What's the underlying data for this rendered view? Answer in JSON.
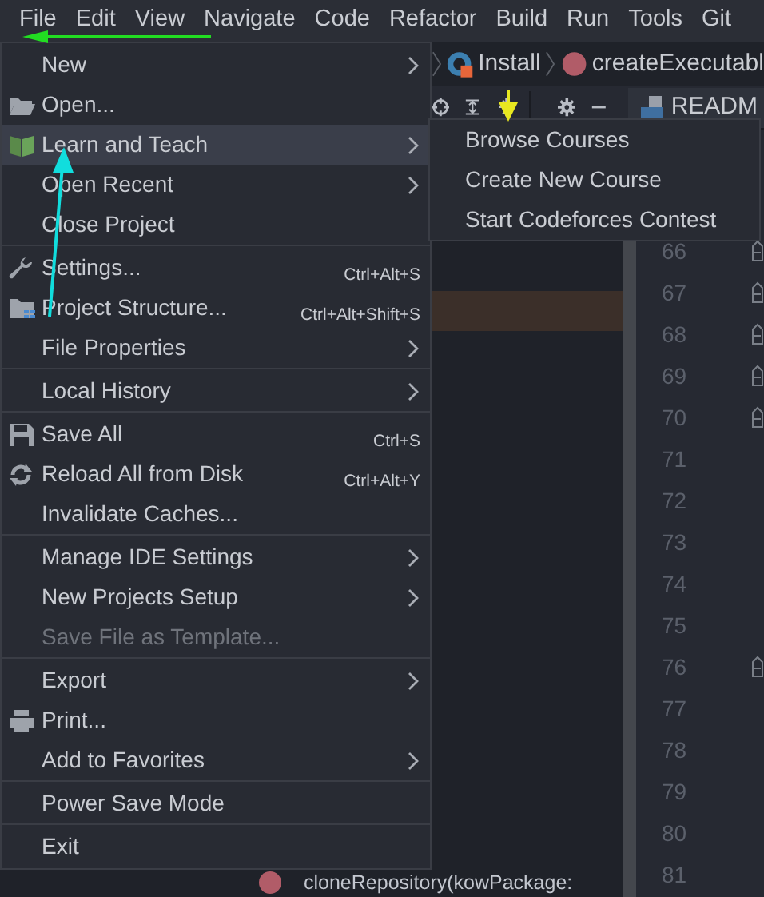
{
  "menu_bar": [
    "File",
    "Edit",
    "View",
    "Navigate",
    "Code",
    "Refactor",
    "Build",
    "Run",
    "Tools",
    "Git"
  ],
  "breadcrumb": [
    "Install",
    "createExecutabl"
  ],
  "editor_tab": "READM",
  "file_menu": {
    "groups": [
      [
        {
          "label": "New",
          "submenu": true,
          "selected": false,
          "disabled": false
        },
        {
          "label": "Open...",
          "submenu": false,
          "selected": false,
          "disabled": false
        },
        {
          "label": "Learn and Teach",
          "submenu": true,
          "selected": true,
          "disabled": false
        },
        {
          "label": "Open Recent",
          "submenu": true,
          "selected": false,
          "disabled": false
        },
        {
          "label": "Close Project",
          "submenu": false,
          "selected": false,
          "disabled": false
        }
      ],
      [
        {
          "label": "Settings...",
          "shortcut": "Ctrl+Alt+S",
          "submenu": false,
          "selected": false,
          "disabled": false
        },
        {
          "label": "Project Structure...",
          "shortcut": "Ctrl+Alt+Shift+S",
          "submenu": false,
          "selected": false,
          "disabled": false
        },
        {
          "label": "File Properties",
          "submenu": true,
          "selected": false,
          "disabled": false
        }
      ],
      [
        {
          "label": "Local History",
          "submenu": true,
          "selected": false,
          "disabled": false
        }
      ],
      [
        {
          "label": "Save All",
          "shortcut": "Ctrl+S",
          "submenu": false,
          "selected": false,
          "disabled": false
        },
        {
          "label": "Reload All from Disk",
          "shortcut": "Ctrl+Alt+Y",
          "submenu": false,
          "selected": false,
          "disabled": false
        },
        {
          "label": "Invalidate Caches...",
          "submenu": false,
          "selected": false,
          "disabled": false
        }
      ],
      [
        {
          "label": "Manage IDE Settings",
          "submenu": true,
          "selected": false,
          "disabled": false
        },
        {
          "label": "New Projects Setup",
          "submenu": true,
          "selected": false,
          "disabled": false
        },
        {
          "label": "Save File as Template...",
          "submenu": false,
          "selected": false,
          "disabled": true
        }
      ],
      [
        {
          "label": "Export",
          "submenu": true,
          "selected": false,
          "disabled": false
        },
        {
          "label": "Print...",
          "submenu": false,
          "selected": false,
          "disabled": false
        },
        {
          "label": "Add to Favorites",
          "submenu": true,
          "selected": false,
          "disabled": false
        }
      ],
      [
        {
          "label": "Power Save Mode",
          "submenu": false,
          "selected": false,
          "disabled": false
        }
      ],
      [
        {
          "label": "Exit",
          "submenu": false,
          "selected": false,
          "disabled": false
        }
      ]
    ]
  },
  "submenu": {
    "items": [
      "Browse Courses",
      "Create New Course",
      "Start Codeforces Contest"
    ]
  },
  "line_numbers": [
    {
      "number": "66",
      "fold": true
    },
    {
      "number": "67",
      "fold": true
    },
    {
      "number": "68",
      "fold": true
    },
    {
      "number": "69",
      "fold": true
    },
    {
      "number": "70",
      "fold": true
    },
    {
      "number": "71",
      "fold": false
    },
    {
      "number": "72",
      "fold": false
    },
    {
      "number": "73",
      "fold": false
    },
    {
      "number": "74",
      "fold": false
    },
    {
      "number": "75",
      "fold": false
    },
    {
      "number": "76",
      "fold": true
    },
    {
      "number": "77",
      "fold": false
    },
    {
      "number": "78",
      "fold": false
    },
    {
      "number": "79",
      "fold": false
    },
    {
      "number": "80",
      "fold": false
    },
    {
      "number": "81",
      "fold": false
    }
  ],
  "code_fragment": "cloneRepository(kowPackage:"
}
